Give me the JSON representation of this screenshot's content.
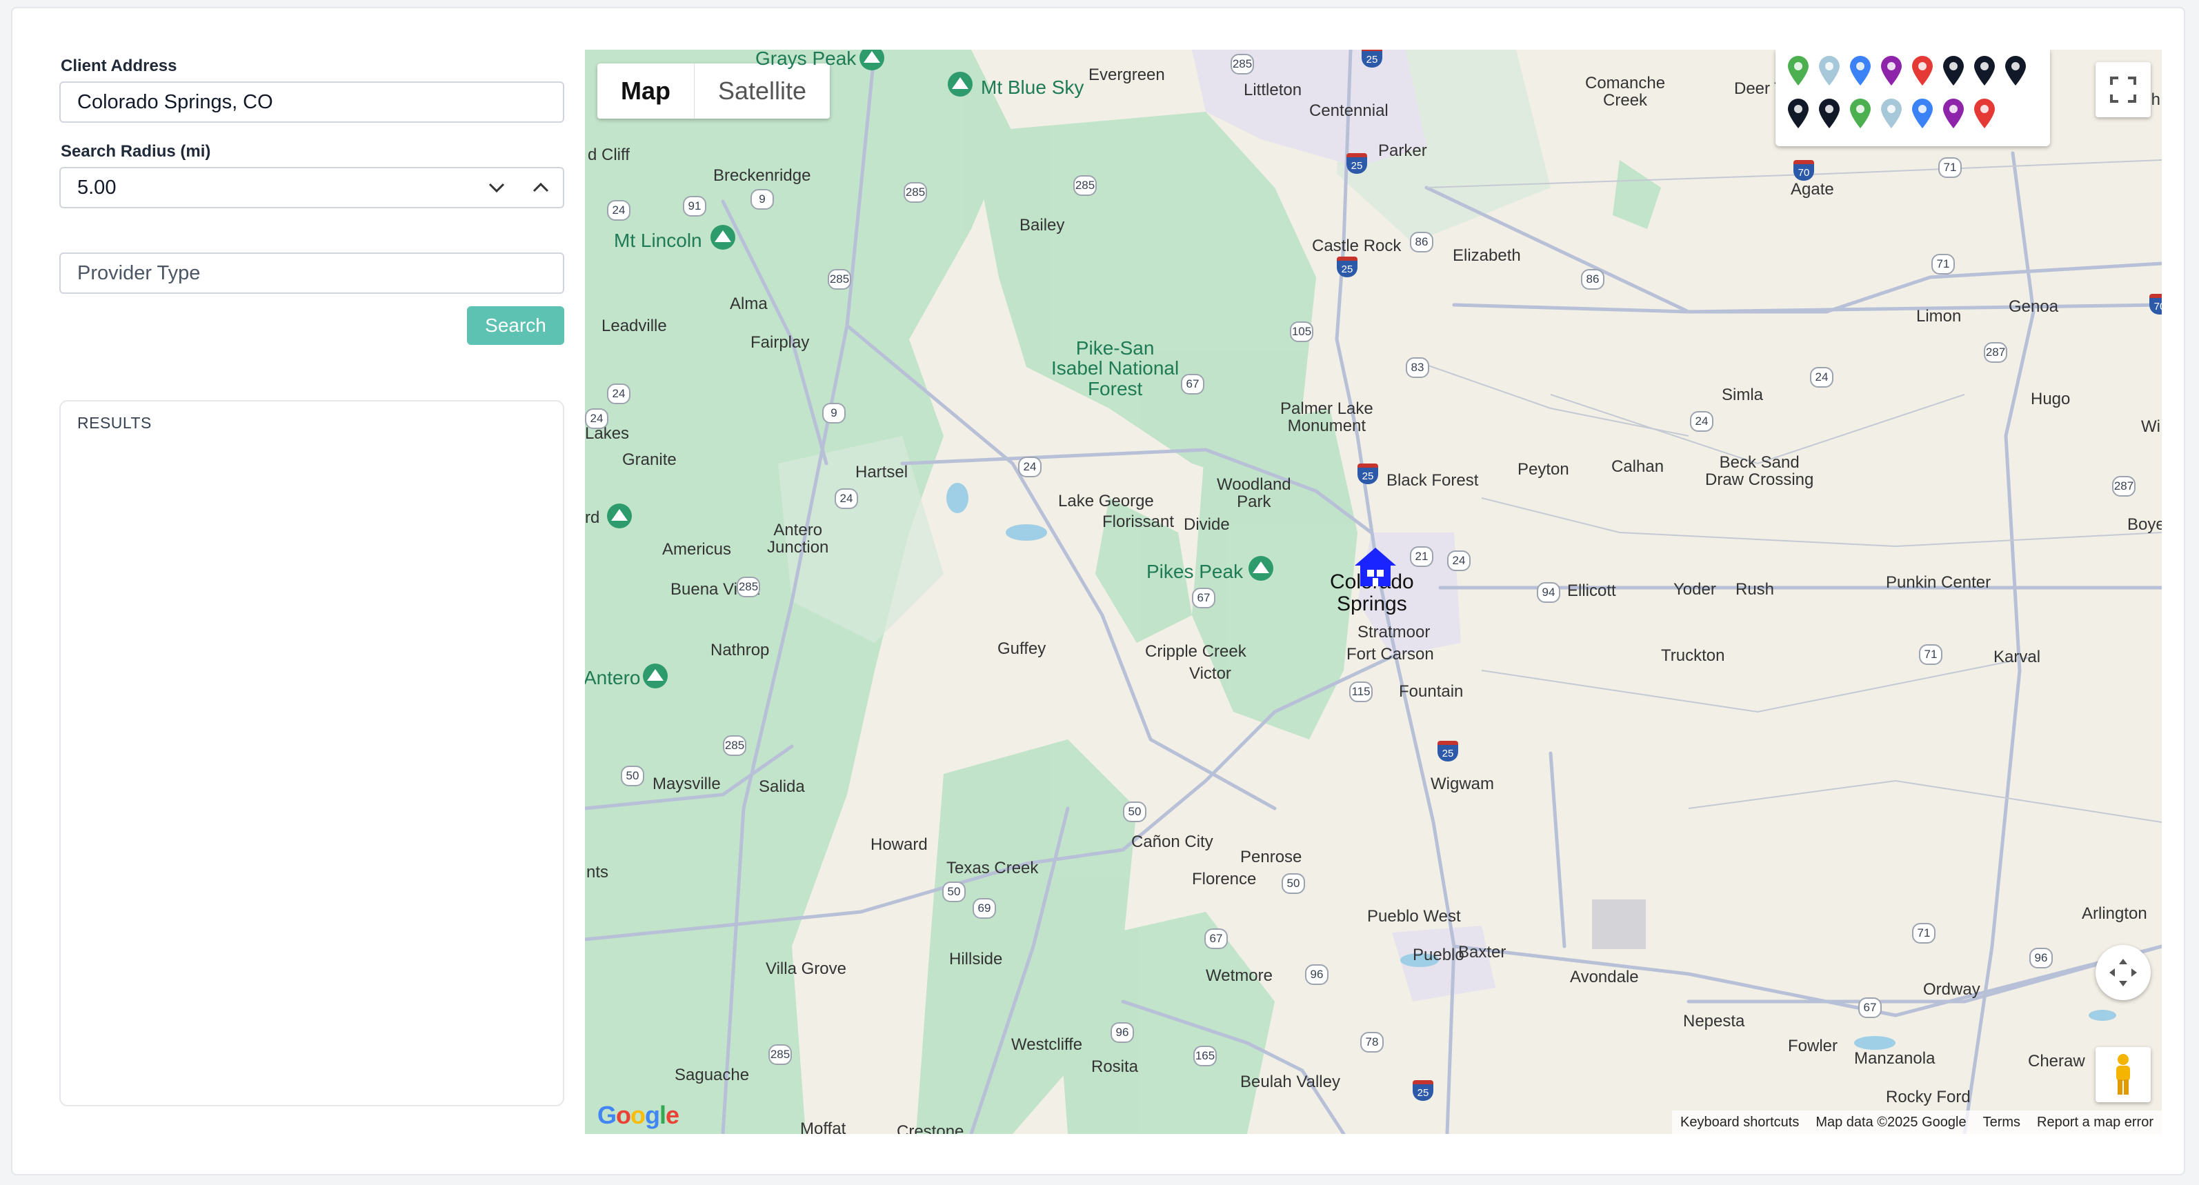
{
  "form": {
    "address_label": "Client Address",
    "address_value": "Colorado Springs, CO",
    "radius_label": "Search Radius (mi)",
    "radius_value": "5.00",
    "provider_placeholder": "Provider Type",
    "search_label": "Search"
  },
  "results": {
    "title": "RESULTS"
  },
  "map": {
    "type_map": "Map",
    "type_satellite": "Satellite",
    "footer": {
      "shortcuts": "Keyboard shortcuts",
      "data": "Map data ©2025 Google",
      "terms": "Terms",
      "report": "Report a map error"
    },
    "logo": "Google",
    "legend_pin_colors": [
      "#4caf50",
      "#a6c8d8",
      "#3b82f6",
      "#8e24aa",
      "#e53935",
      "#111827",
      "#111827",
      "#111827",
      "#111827",
      "#111827",
      "#4caf50",
      "#a6c8d8",
      "#3b82f6",
      "#8e24aa",
      "#e53935"
    ],
    "places": {
      "grays_peak": "Grays Peak",
      "mt_blue_sky": "Mt Blue Sky",
      "evergreen": "Evergreen",
      "littleton": "Littleton",
      "centennial": "Centennial",
      "comanche_creek": "Comanche\nCreek",
      "deer_trail": "Deer T",
      "parker": "Parker",
      "agate": "Agate",
      "red_cliff": "d Cliff",
      "breckenridge": "Breckenridge",
      "bailey": "Bailey",
      "mt_lincoln": "Mt Lincoln",
      "castle_rock": "Castle Rock",
      "elizabeth": "Elizabeth",
      "alma": "Alma",
      "leadville": "Leadville",
      "fairplay": "Fairplay",
      "pike_san_isabel": "Pike-San\nIsabel National\nForest",
      "limon": "Limon",
      "genoa": "Genoa",
      "simla": "Simla",
      "hugo": "Hugo",
      "palmer_lake": "Palmer Lake\nMonument",
      "twin_lakes": "Lakes",
      "granite": "Granite",
      "hartsel": "Hartsel",
      "black_forest": "Black Forest",
      "peyton": "Peyton",
      "calhan": "Calhan",
      "beck_sand": "Beck Sand\nDraw Crossing",
      "woodland_park": "Woodland\nPark",
      "lake_george": "Lake George",
      "florissant": "Florissant",
      "divide": "Divide",
      "antero_junction": "Antero\nJunction",
      "americus": "Americus",
      "buena_vista": "Buena Vista",
      "pikes_peak": "Pikes Peak",
      "colorado_springs": "Colorado\nSprings",
      "ellicott": "Ellicott",
      "yoder": "Yoder",
      "rush": "Rush",
      "punkin_center": "Punkin Center",
      "boyero": "Boyer",
      "wild": "Wi",
      "stratmoor": "Stratmoor",
      "nathrop": "Nathrop",
      "guffey": "Guffey",
      "cripple_creek": "Cripple Creek",
      "victor": "Victor",
      "fort_carson": "Fort Carson",
      "truckton": "Truckton",
      "karval": "Karval",
      "antero": "Antero",
      "fountain": "Fountain",
      "maysville": "Maysville",
      "salida": "Salida",
      "wigwam": "Wigwam",
      "howard": "Howard",
      "canon_city": "Cañon City",
      "penrose": "Penrose",
      "texas_creek": "Texas Creek",
      "mts": "nts",
      "florence": "Florence",
      "pueblo_west": "Pueblo West",
      "arlington": "Arlington",
      "villa_grove": "Villa Grove",
      "hillside": "Hillside",
      "wetmore": "Wetmore",
      "pueblo": "Pueblo",
      "baxter": "Baxter",
      "avondale": "Avondale",
      "ordway": "Ordway",
      "nepesta": "Nepesta",
      "fowler": "Fowler",
      "manzanola": "Manzanola",
      "cheraw": "Cheraw",
      "westcliffe": "Westcliffe",
      "rosita": "Rosita",
      "beulah_valley": "Beulah Valley",
      "saguache": "Saguache",
      "rocky_ford": "Rocky Ford",
      "moffat": "Moffat",
      "crestone": "Crestone",
      "red_tr": "rd",
      "th": "Th"
    },
    "shields": [
      "285",
      "285",
      "285",
      "24",
      "91",
      "9",
      "285",
      "285",
      "285",
      "24",
      "24",
      "9",
      "24",
      "24",
      "285",
      "50",
      "285",
      "67",
      "105",
      "83",
      "67",
      "86",
      "86",
      "24",
      "24",
      "21",
      "24",
      "94",
      "67",
      "115",
      "50",
      "50",
      "50",
      "69",
      "67",
      "96",
      "96",
      "78",
      "165",
      "96",
      "285",
      "71",
      "71",
      "71",
      "71",
      "287",
      "287"
    ],
    "interstates": [
      "25",
      "25",
      "25",
      "25",
      "70",
      "70",
      "25",
      "25"
    ]
  }
}
